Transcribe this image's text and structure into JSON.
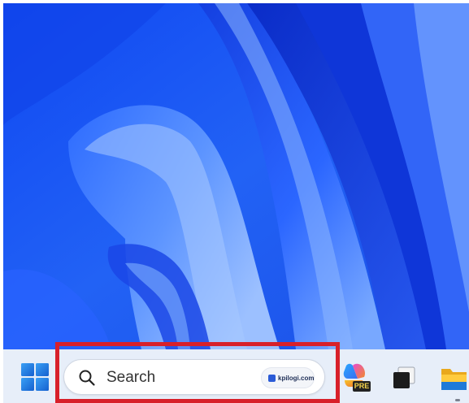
{
  "desktop": {
    "wallpaper": "windows-11-bloom",
    "colors": {
      "base": "#1e54f0",
      "dark": "#0b2fd0",
      "light": "#8fb6ff",
      "mid": "#3f7aff"
    }
  },
  "taskbar": {
    "background": "#e7eef9",
    "start": {
      "icon": "windows-logo-icon",
      "color": "#1c6ed4"
    },
    "search": {
      "icon": "search-icon",
      "placeholder": "Search",
      "highlight_logo_text": "kpilogi.com"
    },
    "highlight_frame_color": "#d8202a",
    "copilot": {
      "icon": "copilot-icon",
      "badge": "PRE"
    },
    "task_view": {
      "icon": "task-view-icon"
    },
    "file_explorer": {
      "icon": "folder-icon",
      "running": true
    }
  }
}
